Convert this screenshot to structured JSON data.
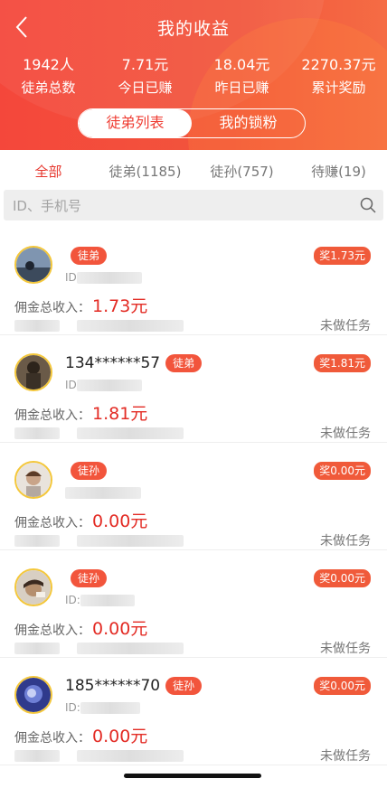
{
  "header": {
    "title": "我的收益",
    "stats": [
      {
        "value": "1942人",
        "label": "徒弟总数"
      },
      {
        "value": "7.71元",
        "label": "今日已赚"
      },
      {
        "value": "18.04元",
        "label": "昨日已赚"
      },
      {
        "value": "2270.37元",
        "label": "累计奖励"
      }
    ],
    "switch": {
      "active": "徒弟列表",
      "inactive": "我的锁粉"
    }
  },
  "tabs": [
    "全部",
    "徒弟(1185)",
    "徒孙(757)",
    "待赚(19)"
  ],
  "search": {
    "placeholder": "ID、手机号"
  },
  "items": [
    {
      "phone": "",
      "tag": "徒弟",
      "id_prefix": "ID",
      "reward": "奖1.73元",
      "income_label": "佣金总收入：",
      "income": "1.73元",
      "status": "未做任务"
    },
    {
      "phone": "134******57",
      "tag": "徒弟",
      "id_prefix": "ID",
      "reward": "奖1.81元",
      "income_label": "佣金总收入：",
      "income": "1.81元",
      "status": "未做任务"
    },
    {
      "phone": "",
      "tag": "徒孙",
      "id_prefix": "",
      "reward": "奖0.00元",
      "income_label": "佣金总收入：",
      "income": "0.00元",
      "status": "未做任务"
    },
    {
      "phone": "",
      "tag": "徒孙",
      "id_prefix": "ID:",
      "reward": "奖0.00元",
      "income_label": "佣金总收入：",
      "income": "0.00元",
      "status": "未做任务"
    },
    {
      "phone": "185******70",
      "tag": "徒孙",
      "id_prefix": "ID:",
      "reward": "奖0.00元",
      "income_label": "佣金总收入：",
      "income": "0.00元",
      "status": "未做任务"
    }
  ],
  "colors": {
    "brand": "#f2553c",
    "accent_text": "#e32b24",
    "avatar_ring": "#f4c73a"
  }
}
